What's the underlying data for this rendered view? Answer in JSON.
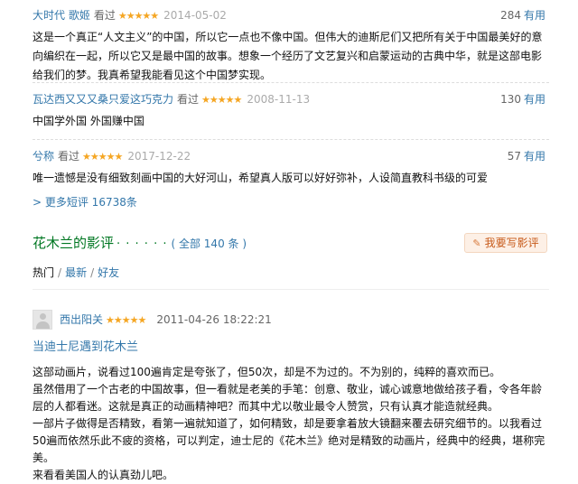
{
  "short_comments": [
    {
      "user": "大时代 歌姬",
      "status": "看过",
      "rating_stars": 5,
      "time": "2014-05-02",
      "votes": "284",
      "useful_label": "有用",
      "text": "这是一个真正“人文主义”的中国，所以它一点也不像中国。但伟大的迪斯尼们又把所有关于中国最美好的意向编织在一起，所以它又是最中国的故事。想象一个经历了文艺复兴和启蒙运动的古典中华，就是这部电影给我们的梦。我真希望我能看见这个中国梦实现。"
    },
    {
      "user": "瓦达西又又又桑只爱这巧克力",
      "status": "看过",
      "rating_stars": 5,
      "time": "2008-11-13",
      "votes": "130",
      "useful_label": "有用",
      "text": "中国学外国 外国赚中国"
    },
    {
      "user": "兮称",
      "status": "看过",
      "rating_stars": 5,
      "time": "2017-12-22",
      "votes": "57",
      "useful_label": "有用",
      "text": "唯一遗憾是没有细致刻画中国的大好河山，希望真人版可以好好弥补，人设简直教科书级的可爱"
    }
  ],
  "more_short_comments": "> 更多短评 16738条",
  "reviews_section": {
    "title": "花木兰的影评",
    "dots": "· · · · · ·",
    "total": "( 全部 140 条 )",
    "write_button": "我要写影评",
    "tabs": {
      "hot": "热门",
      "latest": "最新",
      "friends": "好友",
      "sep": "/"
    }
  },
  "review": {
    "user": "西出阳关",
    "rating_stars": 5,
    "time": "2011-04-26 18:22:21",
    "title": "当迪士尼遇到花木兰",
    "paragraphs": [
      "这部动画片，说看过100遍肯定是夸张了，但50次，却是不为过的。不为别的，纯粹的喜欢而已。",
      "虽然借用了一个古老的中国故事，但一看就是老美的手笔：创意、敬业，诚心诚意地做给孩子看，令各年龄层的人都看迷。这就是真正的动画精神吧？而其中尤以敬业最令人赞赏，只有认真才能造就经典。",
      "一部片子做得是否精致，看第一遍就知道了，如何精致，却是要拿着放大镜翻来覆去研究细节的。以我看过50遍而依然乐此不疲的资格，可以判定，迪士尼的《花木兰》绝对是精致的动画片，经典中的经典，堪称完美。",
      "来看看美国人的认真劲儿吧。"
    ]
  },
  "colors": {
    "link": "#3377aa",
    "section_title": "#007722",
    "star": "#f5a623",
    "button_bg": "#fdf0e6"
  },
  "icons": {
    "star": "star-icon",
    "pencil": "pencil-icon",
    "avatar": "default-avatar"
  }
}
